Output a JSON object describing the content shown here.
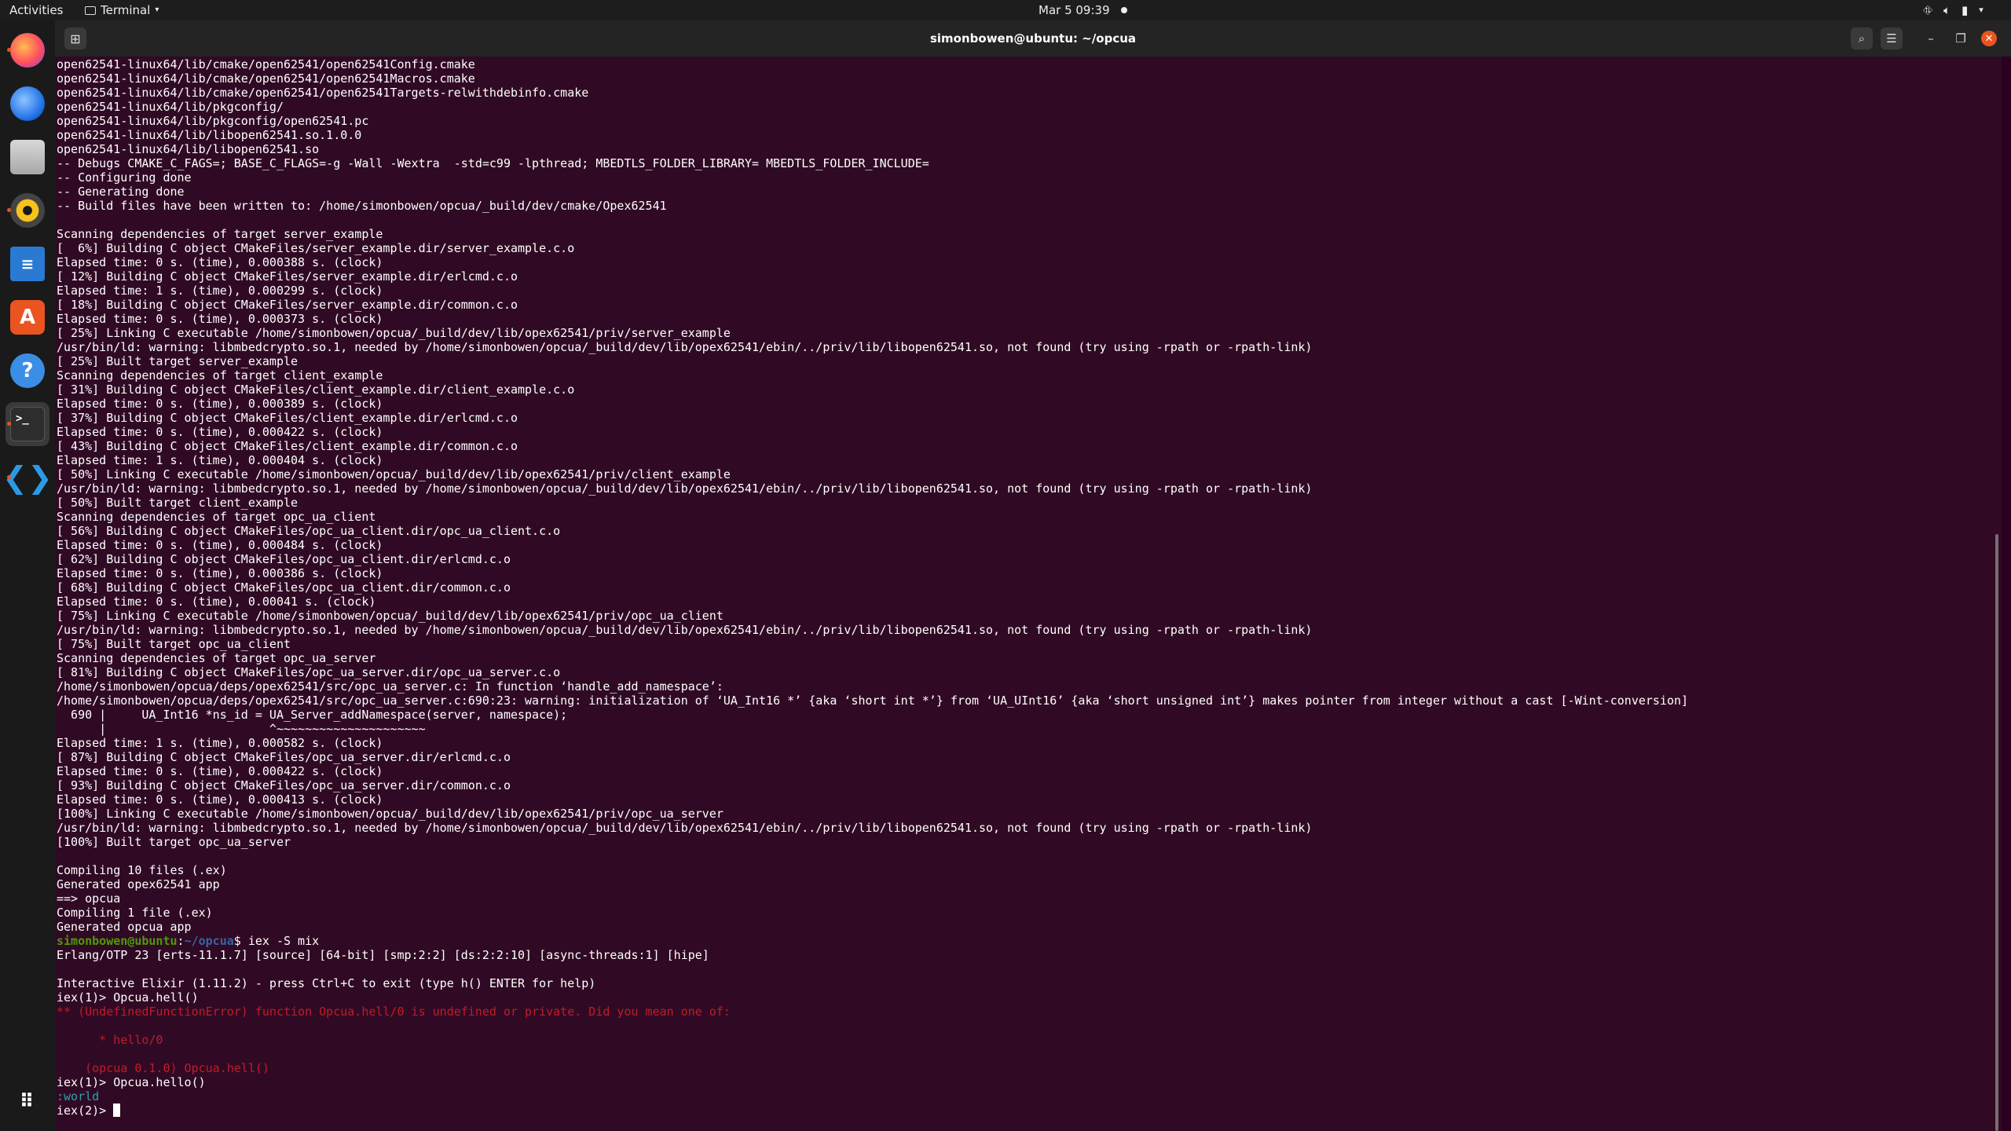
{
  "topbar": {
    "activities": "Activities",
    "app_name": "Terminal",
    "clock": "Mar 5  09:39"
  },
  "dock": {
    "apps": [
      "firefox-icon",
      "thunderbird-icon",
      "files-icon",
      "rhythmbox-icon",
      "writer-icon",
      "software-icon",
      "help-icon",
      "terminal-icon",
      "vscode-icon"
    ]
  },
  "window": {
    "title": "simonbowen@ubuntu: ~/opcua"
  },
  "terminal": {
    "lines": [
      {
        "text": "open62541-linux64/lib/cmake/open62541/open62541Config.cmake"
      },
      {
        "text": "open62541-linux64/lib/cmake/open62541/open62541Macros.cmake"
      },
      {
        "text": "open62541-linux64/lib/cmake/open62541/open62541Targets-relwithdebinfo.cmake"
      },
      {
        "text": "open62541-linux64/lib/pkgconfig/"
      },
      {
        "text": "open62541-linux64/lib/pkgconfig/open62541.pc"
      },
      {
        "text": "open62541-linux64/lib/libopen62541.so.1.0.0"
      },
      {
        "text": "open62541-linux64/lib/libopen62541.so"
      },
      {
        "text": "-- Debugs CMAKE_C_FAGS=; BASE_C_FLAGS=-g -Wall -Wextra  -std=c99 -lpthread; MBEDTLS_FOLDER_LIBRARY= MBEDTLS_FOLDER_INCLUDE="
      },
      {
        "text": "-- Configuring done"
      },
      {
        "text": "-- Generating done"
      },
      {
        "text": "-- Build files have been written to: /home/simonbowen/opcua/_build/dev/cmake/Opex62541"
      },
      {
        "text": ""
      },
      {
        "text": "Scanning dependencies of target server_example"
      },
      {
        "text": "[  6%] Building C object CMakeFiles/server_example.dir/server_example.c.o"
      },
      {
        "text": "Elapsed time: 0 s. (time), 0.000388 s. (clock)"
      },
      {
        "text": "[ 12%] Building C object CMakeFiles/server_example.dir/erlcmd.c.o"
      },
      {
        "text": "Elapsed time: 1 s. (time), 0.000299 s. (clock)"
      },
      {
        "text": "[ 18%] Building C object CMakeFiles/server_example.dir/common.c.o"
      },
      {
        "text": "Elapsed time: 0 s. (time), 0.000373 s. (clock)"
      },
      {
        "text": "[ 25%] Linking C executable /home/simonbowen/opcua/_build/dev/lib/opex62541/priv/server_example"
      },
      {
        "text": "/usr/bin/ld: warning: libmbedcrypto.so.1, needed by /home/simonbowen/opcua/_build/dev/lib/opex62541/ebin/../priv/lib/libopen62541.so, not found (try using -rpath or -rpath-link)"
      },
      {
        "text": "[ 25%] Built target server_example"
      },
      {
        "text": "Scanning dependencies of target client_example"
      },
      {
        "text": "[ 31%] Building C object CMakeFiles/client_example.dir/client_example.c.o"
      },
      {
        "text": "Elapsed time: 0 s. (time), 0.000389 s. (clock)"
      },
      {
        "text": "[ 37%] Building C object CMakeFiles/client_example.dir/erlcmd.c.o"
      },
      {
        "text": "Elapsed time: 0 s. (time), 0.000422 s. (clock)"
      },
      {
        "text": "[ 43%] Building C object CMakeFiles/client_example.dir/common.c.o"
      },
      {
        "text": "Elapsed time: 1 s. (time), 0.000404 s. (clock)"
      },
      {
        "text": "[ 50%] Linking C executable /home/simonbowen/opcua/_build/dev/lib/opex62541/priv/client_example"
      },
      {
        "text": "/usr/bin/ld: warning: libmbedcrypto.so.1, needed by /home/simonbowen/opcua/_build/dev/lib/opex62541/ebin/../priv/lib/libopen62541.so, not found (try using -rpath or -rpath-link)"
      },
      {
        "text": "[ 50%] Built target client_example"
      },
      {
        "text": "Scanning dependencies of target opc_ua_client"
      },
      {
        "text": "[ 56%] Building C object CMakeFiles/opc_ua_client.dir/opc_ua_client.c.o"
      },
      {
        "text": "Elapsed time: 0 s. (time), 0.000484 s. (clock)"
      },
      {
        "text": "[ 62%] Building C object CMakeFiles/opc_ua_client.dir/erlcmd.c.o"
      },
      {
        "text": "Elapsed time: 0 s. (time), 0.000386 s. (clock)"
      },
      {
        "text": "[ 68%] Building C object CMakeFiles/opc_ua_client.dir/common.c.o"
      },
      {
        "text": "Elapsed time: 0 s. (time), 0.00041 s. (clock)"
      },
      {
        "text": "[ 75%] Linking C executable /home/simonbowen/opcua/_build/dev/lib/opex62541/priv/opc_ua_client"
      },
      {
        "text": "/usr/bin/ld: warning: libmbedcrypto.so.1, needed by /home/simonbowen/opcua/_build/dev/lib/opex62541/ebin/../priv/lib/libopen62541.so, not found (try using -rpath or -rpath-link)"
      },
      {
        "text": "[ 75%] Built target opc_ua_client"
      },
      {
        "text": "Scanning dependencies of target opc_ua_server"
      },
      {
        "text": "[ 81%] Building C object CMakeFiles/opc_ua_server.dir/opc_ua_server.c.o"
      },
      {
        "text": "/home/simonbowen/opcua/deps/opex62541/src/opc_ua_server.c: In function ‘handle_add_namespace’:"
      },
      {
        "text": "/home/simonbowen/opcua/deps/opex62541/src/opc_ua_server.c:690:23: warning: initialization of ‘UA_Int16 *’ {aka ‘short int *’} from ‘UA_UInt16’ {aka ‘short unsigned int’} makes pointer from integer without a cast [-Wint-conversion]"
      },
      {
        "text": "  690 |     UA_Int16 *ns_id = UA_Server_addNamespace(server, namespace);"
      },
      {
        "text": "      |                       ^~~~~~~~~~~~~~~~~~~~~~"
      },
      {
        "text": "Elapsed time: 1 s. (time), 0.000582 s. (clock)"
      },
      {
        "text": "[ 87%] Building C object CMakeFiles/opc_ua_server.dir/erlcmd.c.o"
      },
      {
        "text": "Elapsed time: 0 s. (time), 0.000422 s. (clock)"
      },
      {
        "text": "[ 93%] Building C object CMakeFiles/opc_ua_server.dir/common.c.o"
      },
      {
        "text": "Elapsed time: 0 s. (time), 0.000413 s. (clock)"
      },
      {
        "text": "[100%] Linking C executable /home/simonbowen/opcua/_build/dev/lib/opex62541/priv/opc_ua_server"
      },
      {
        "text": "/usr/bin/ld: warning: libmbedcrypto.so.1, needed by /home/simonbowen/opcua/_build/dev/lib/opex62541/ebin/../priv/lib/libopen62541.so, not found (try using -rpath or -rpath-link)"
      },
      {
        "text": "[100%] Built target opc_ua_server"
      },
      {
        "text": ""
      },
      {
        "text": "Compiling 10 files (.ex)"
      },
      {
        "text": "Generated opex62541 app"
      },
      {
        "text": "==> opcua"
      },
      {
        "text": "Compiling 1 file (.ex)"
      },
      {
        "text": "Generated opcua app"
      },
      {
        "prompt": true,
        "user": "simonbowen@ubuntu",
        "sep": ":",
        "path": "~/opcua",
        "cmd": "$ iex -S mix"
      },
      {
        "text": "Erlang/OTP 23 [erts-11.1.7] [source] [64-bit] [smp:2:2] [ds:2:2:10] [async-threads:1] [hipe]"
      },
      {
        "text": ""
      },
      {
        "text": "Interactive Elixir (1.11.2) - press Ctrl+C to exit (type h() ENTER for help)"
      },
      {
        "text": "iex(1)> Opcua.hell()"
      },
      {
        "text": "** (UndefinedFunctionError) function Opcua.hell/0 is undefined or private. Did you mean one of:",
        "style": "err"
      },
      {
        "text": ""
      },
      {
        "text": "      * hello/0",
        "style": "err"
      },
      {
        "text": ""
      },
      {
        "text": "    (opcua 0.1.0) Opcua.hell()",
        "style": "err"
      },
      {
        "text": "iex(1)> Opcua.hello()"
      },
      {
        "text": ":world",
        "style": "atom"
      },
      {
        "text": "iex(2)> ",
        "cursor": true
      }
    ]
  }
}
